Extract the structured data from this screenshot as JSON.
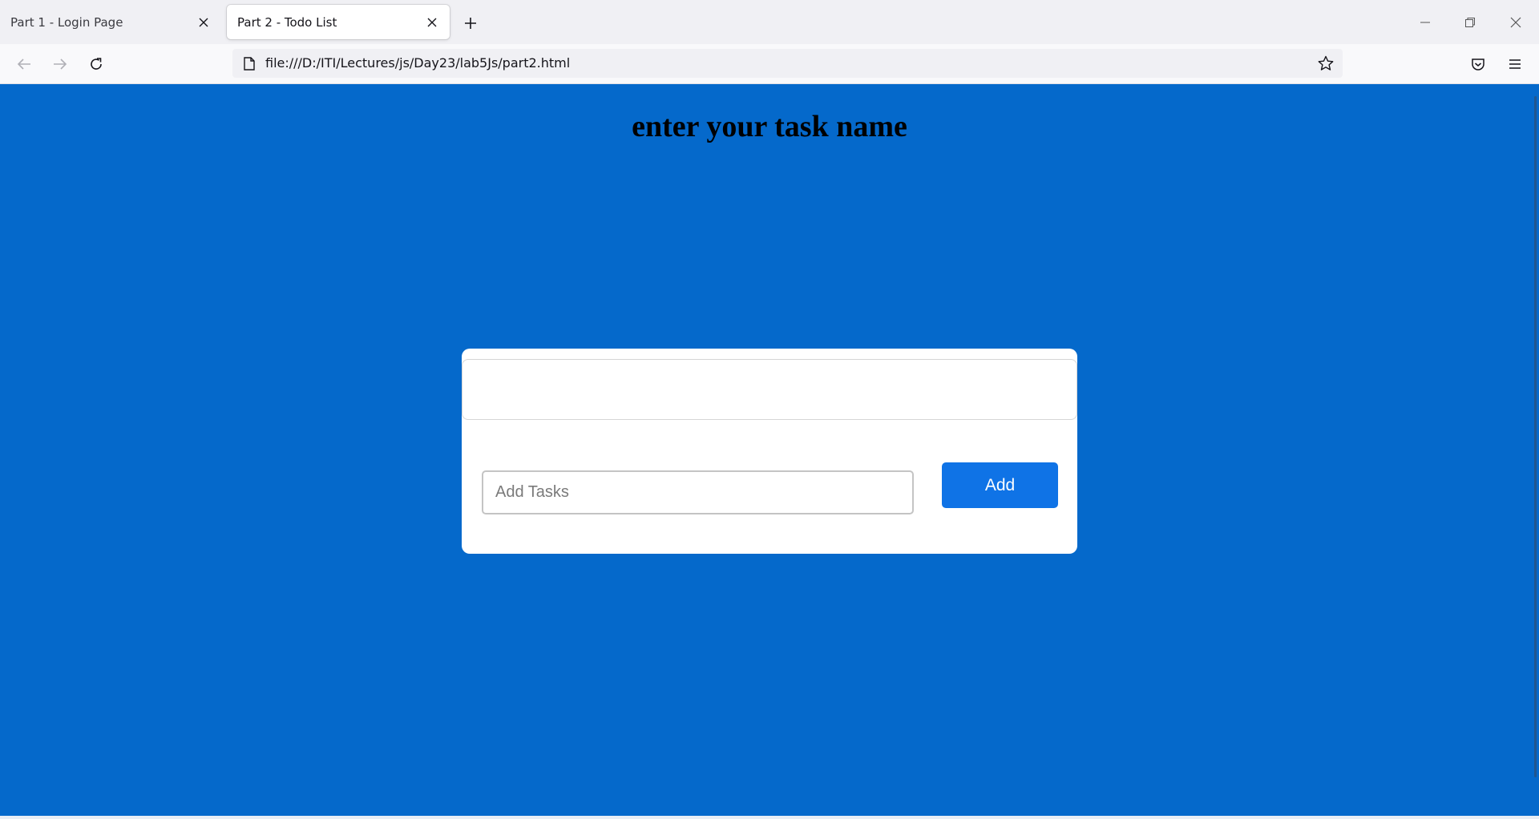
{
  "browser": {
    "tabs": [
      {
        "title": "Part 1 - Login Page",
        "active": false
      },
      {
        "title": "Part 2 - Todo List",
        "active": true
      }
    ],
    "url": "file:///D:/ITI/Lectures/js/Day23/lab5Js/part2.html"
  },
  "page": {
    "background_color": "#0569cb",
    "heading": "enter your task name",
    "task_input": {
      "placeholder": "Add Tasks",
      "value": ""
    },
    "add_button_label": "Add",
    "button_color": "#0f73e6"
  }
}
